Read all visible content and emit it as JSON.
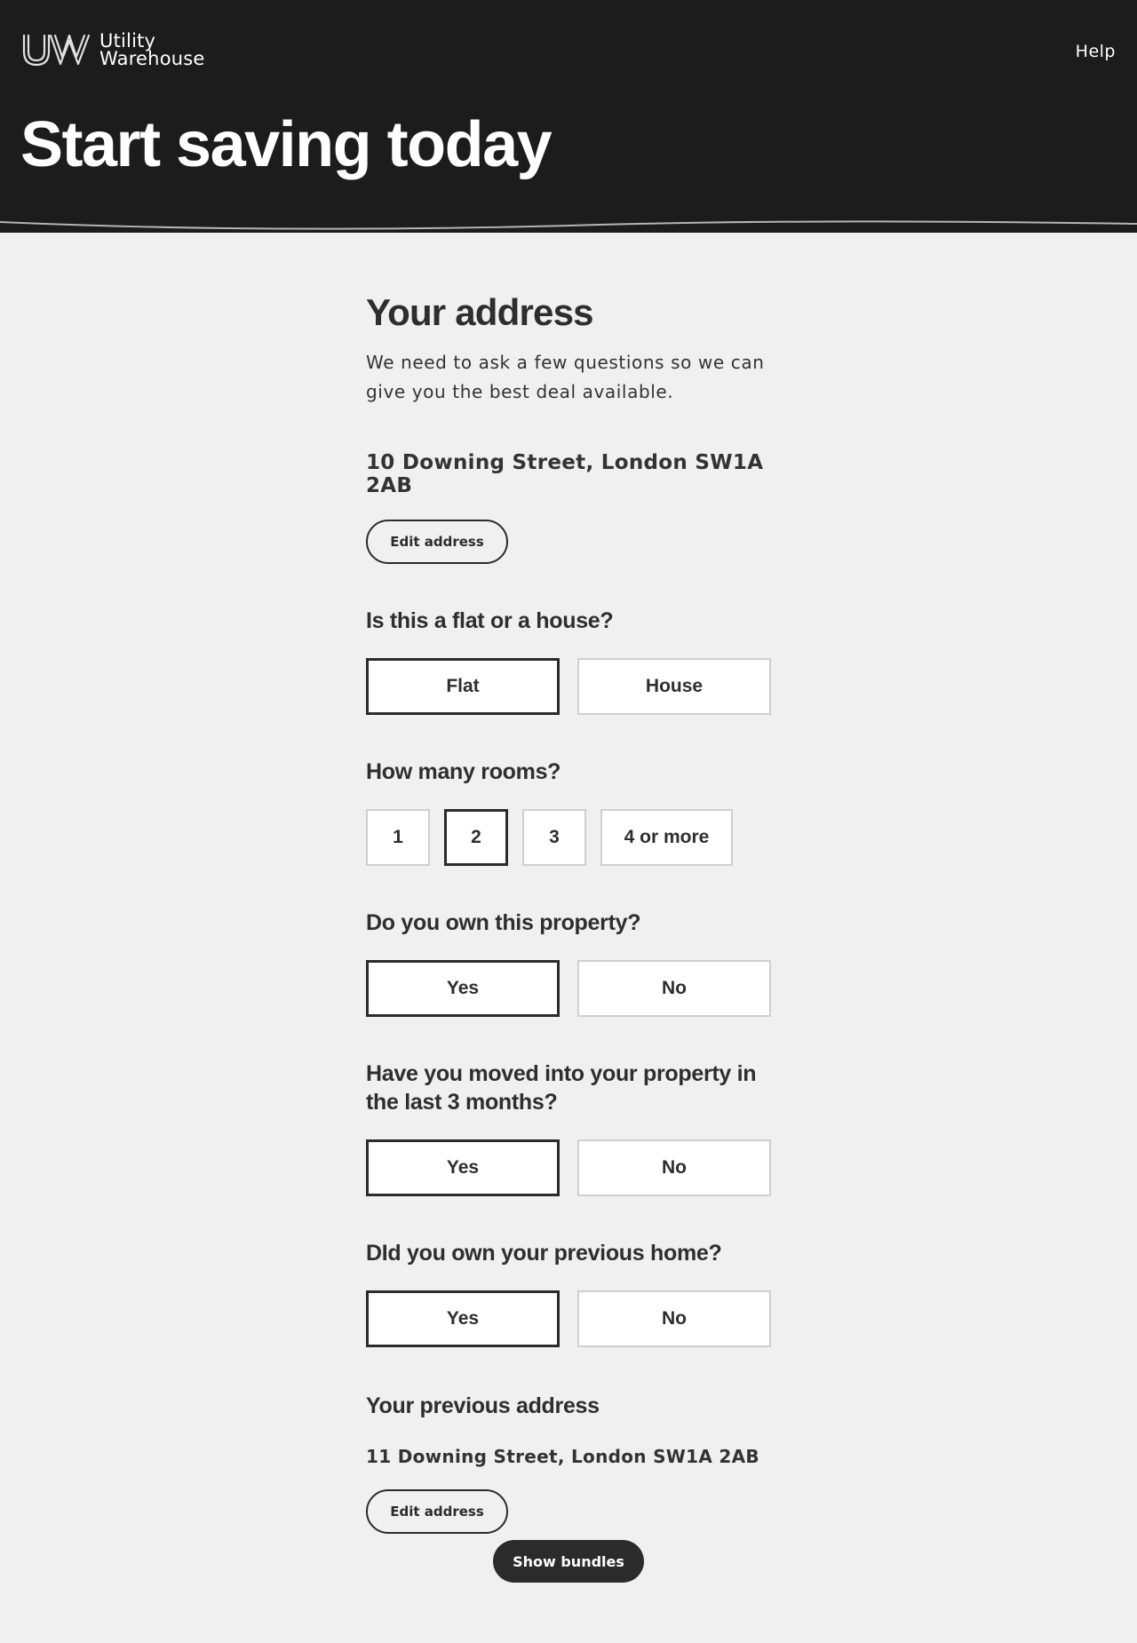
{
  "header": {
    "logo_line1": "Utility",
    "logo_line2": "Warehouse",
    "help_label": "Help",
    "hero_title": "Start saving today",
    "background_color": "#1c1c1c"
  },
  "address_section": {
    "title": "Your address",
    "intro": "We need to ask a few questions so we can give you the best deal available.",
    "current_address": "10 Downing Street, London SW1A 2AB",
    "edit_label": "Edit address"
  },
  "questions": {
    "property_type": {
      "label": "Is this a flat or a house?",
      "options": [
        "Flat",
        "House"
      ],
      "selected": "Flat"
    },
    "rooms": {
      "label": "How many rooms?",
      "options": [
        "1",
        "2",
        "3",
        "4 or more"
      ],
      "selected": "2"
    },
    "own_property": {
      "label": "Do you own this property?",
      "options": [
        "Yes",
        "No"
      ],
      "selected": "Yes"
    },
    "moved_recently": {
      "label": "Have you moved into your property in the last 3 months?",
      "options": [
        "Yes",
        "No"
      ],
      "selected": "Yes"
    },
    "owned_previous": {
      "label": "DId you own your previous home?",
      "options": [
        "Yes",
        "No"
      ],
      "selected": "Yes"
    }
  },
  "previous_address": {
    "title": "Your previous address",
    "address": "11 Downing Street, London SW1A 2AB",
    "edit_label": "Edit address"
  },
  "cta": {
    "label": "Show bundles"
  },
  "colors": {
    "page_background": "#f0f0f0",
    "dark": "#2b2b2b",
    "option_border": "#cfcfcf"
  }
}
